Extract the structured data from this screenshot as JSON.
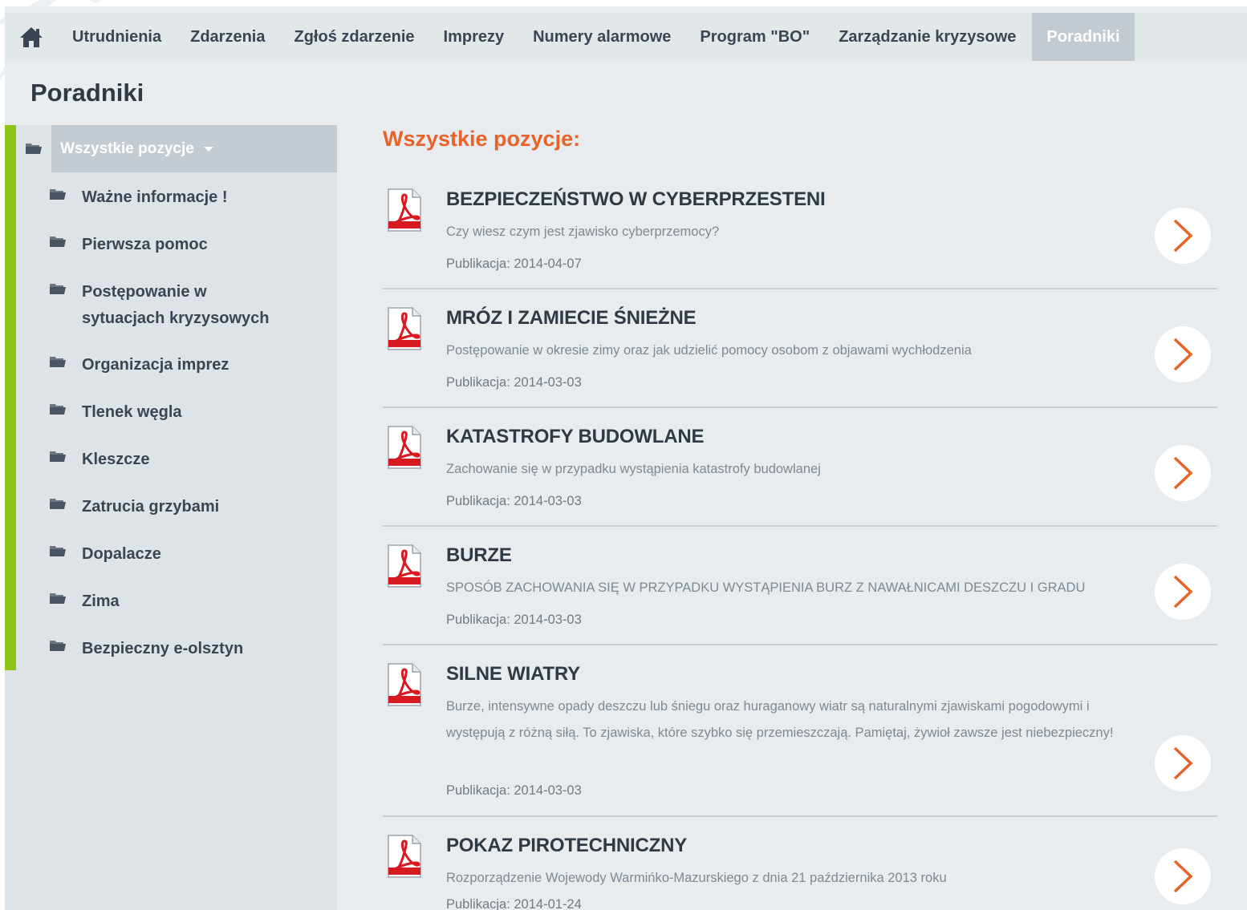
{
  "colors": {
    "accent_green": "#8cc41a",
    "accent_orange": "#e8632a",
    "nav_active_bg": "#c3cbd2",
    "pdf_red": "#d71920"
  },
  "nav": {
    "home_icon": "home-icon",
    "items": [
      {
        "label": "Utrudnienia"
      },
      {
        "label": "Zdarzenia"
      },
      {
        "label": "Zgłoś zdarzenie"
      },
      {
        "label": "Imprezy"
      },
      {
        "label": "Numery alarmowe"
      },
      {
        "label": "Program \"BO\""
      },
      {
        "label": "Zarządzanie kryzysowe"
      },
      {
        "label": "Poradniki",
        "active": true
      }
    ]
  },
  "page": {
    "title": "Poradniki"
  },
  "sidebar": {
    "all_label": "Wszystkie pozycje",
    "items": [
      {
        "label": "Ważne informacje !"
      },
      {
        "label": "Pierwsza pomoc"
      },
      {
        "label": "Postępowanie w sytuacjach kryzysowych"
      },
      {
        "label": "Organizacja imprez"
      },
      {
        "label": "Tlenek węgla"
      },
      {
        "label": "Kleszcze"
      },
      {
        "label": "Zatrucia grzybami"
      },
      {
        "label": "Dopalacze"
      },
      {
        "label": "Zima"
      },
      {
        "label": "Bezpieczny e-olsztyn"
      }
    ]
  },
  "main": {
    "section_title": "Wszystkie pozycje:",
    "entries": [
      {
        "title": "BEZPIECZEŃSTWO W CYBERPRZESTENI",
        "description": "Czy wiesz czym jest zjawisko cyberprzemocy?",
        "publication": "Publikacja: 2014-04-07"
      },
      {
        "title": "MRÓZ I ZAMIECIE ŚNIEŻNE",
        "description": "Postępowanie w okresie zimy oraz jak udzielić pomocy osobom z objawami wychłodzenia",
        "publication": "Publikacja: 2014-03-03"
      },
      {
        "title": "KATASTROFY BUDOWLANE",
        "description": "Zachowanie się w przypadku wystąpienia katastrofy budowlanej",
        "publication": "Publikacja: 2014-03-03"
      },
      {
        "title": "BURZE",
        "description": "SPOSÓB ZACHOWANIA SIĘ W PRZYPADKU WYSTĄPIENIA BURZ Z NAWAŁNICAMI DESZCZU I GRADU",
        "publication": "Publikacja: 2014-03-03"
      },
      {
        "title": "SILNE WIATRY",
        "description": "Burze, intensywne opady deszczu lub śniegu oraz huraganowy wiatr są naturalnymi zjawiskami pogodowymi i występują z różną siłą. To zjawiska, które szybko się przemieszczają. Pamiętaj, żywioł zawsze jest niebezpieczny!",
        "publication": "Publikacja: 2014-03-03"
      },
      {
        "title": "POKAZ PIROTECHNICZNY",
        "description": "Rozporządzenie Wojewody Warmińko-Mazurskiego z dnia 21 października 2013 roku",
        "publication": "Publikacja: 2014-01-24"
      }
    ]
  }
}
